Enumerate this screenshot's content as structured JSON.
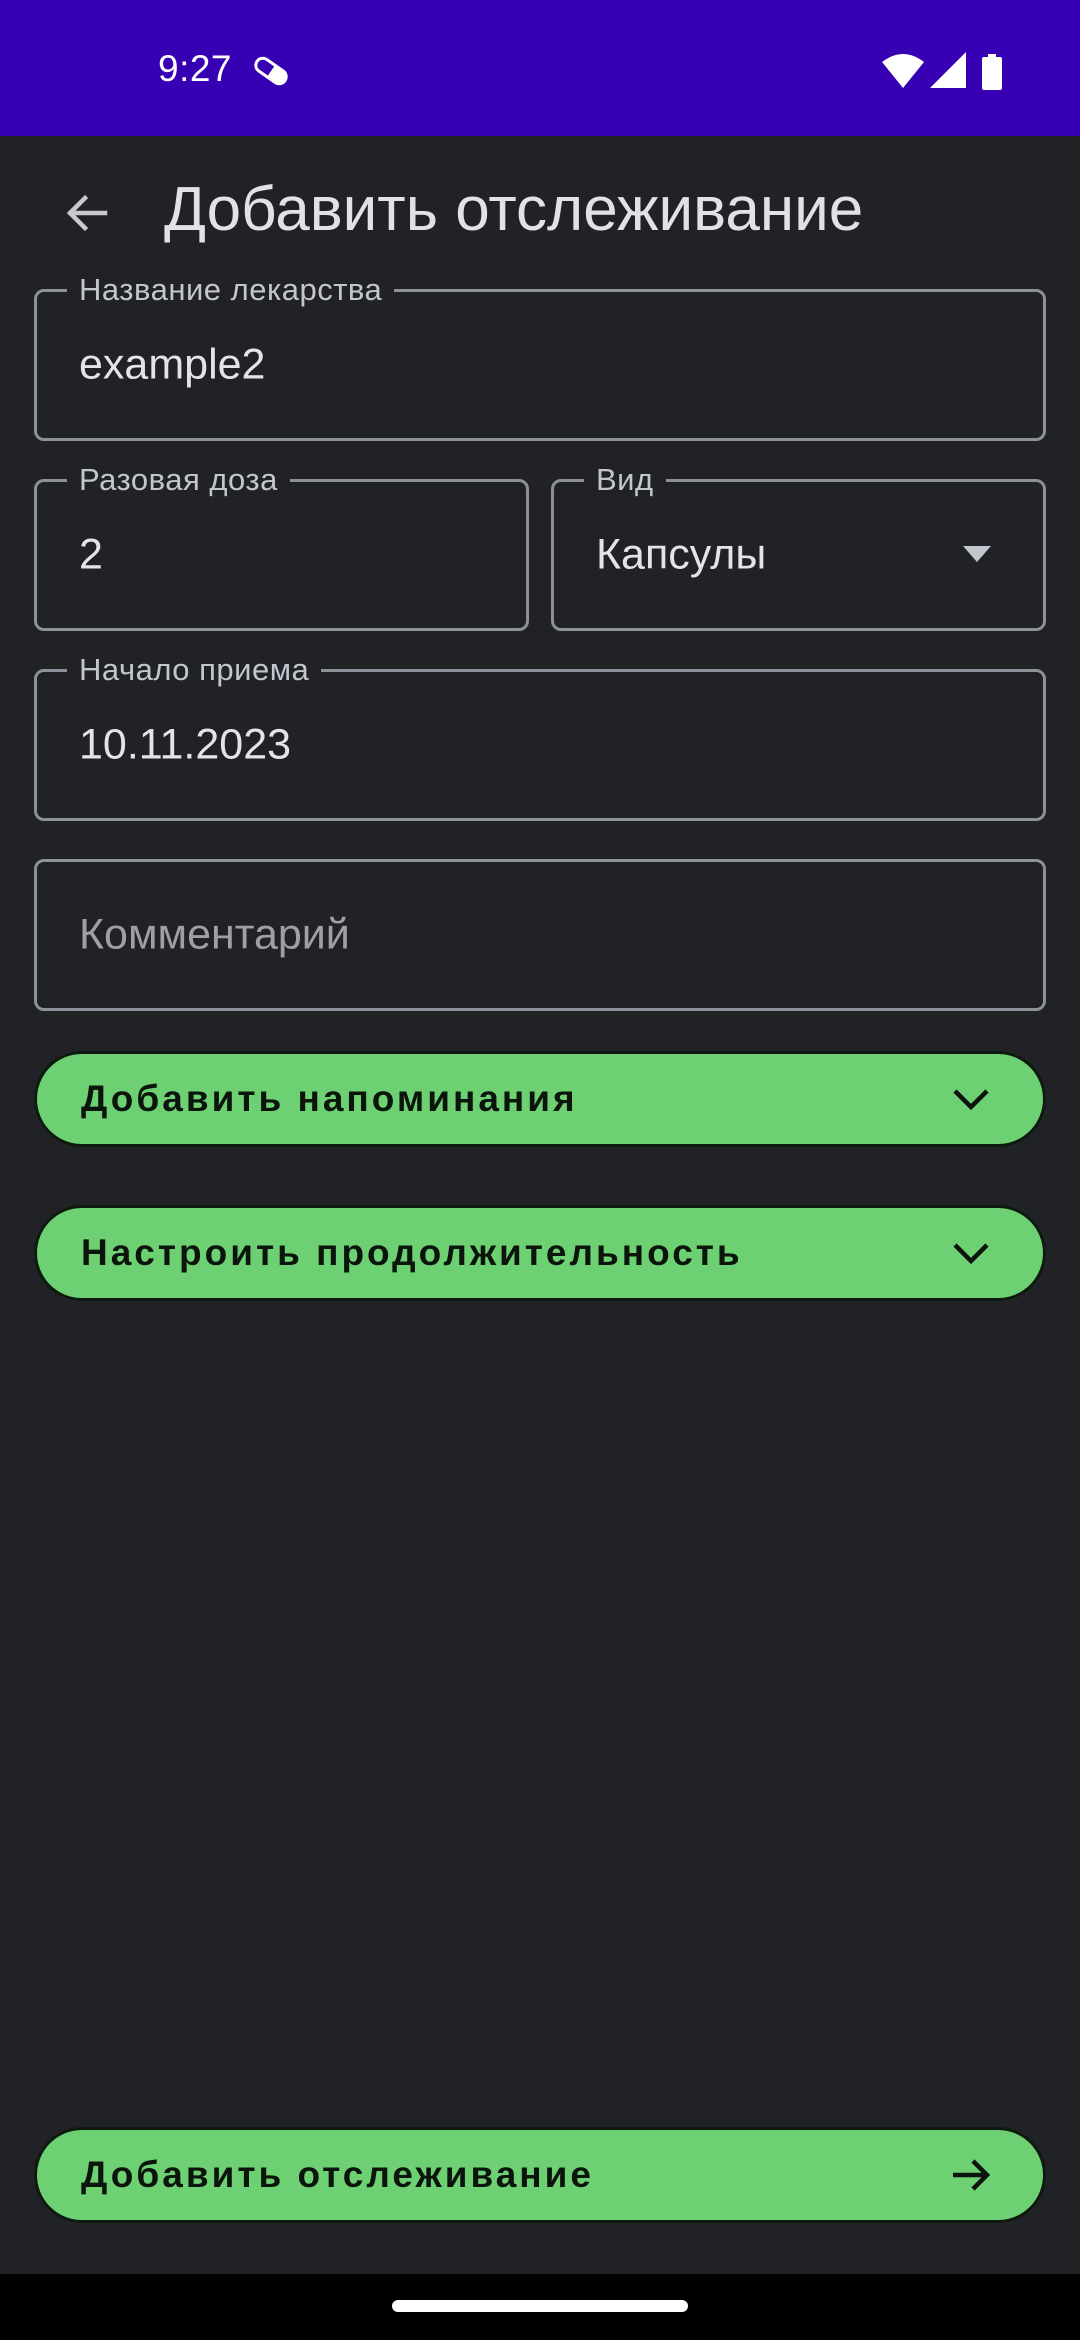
{
  "status_bar": {
    "time": "9:27",
    "notification_icon": "pill-icon",
    "icons": [
      "wifi-icon",
      "signal-icon",
      "battery-icon"
    ],
    "background": "#3700B3"
  },
  "app_bar": {
    "back_icon": "arrow-back-icon",
    "title": "Добавить отслеживание"
  },
  "form": {
    "medicine_name": {
      "label": "Название лекарства",
      "value": "example2"
    },
    "dose": {
      "label": "Разовая доза",
      "value": "2"
    },
    "form_type": {
      "label": "Вид",
      "value": "Капсулы"
    },
    "start_date": {
      "label": "Начало приема",
      "value": "10.11.2023"
    },
    "comment": {
      "placeholder": "Комментарий",
      "value": ""
    }
  },
  "sections": {
    "reminders": {
      "label": "Добавить напоминания",
      "icon": "chevron-down-icon"
    },
    "duration": {
      "label": "Настроить продолжительность",
      "icon": "chevron-down-icon"
    }
  },
  "submit": {
    "label": "Добавить отслеживание",
    "icon": "arrow-forward-icon"
  },
  "colors": {
    "background": "#212226",
    "accent": "#6DD173",
    "outline": "#8E9099"
  }
}
